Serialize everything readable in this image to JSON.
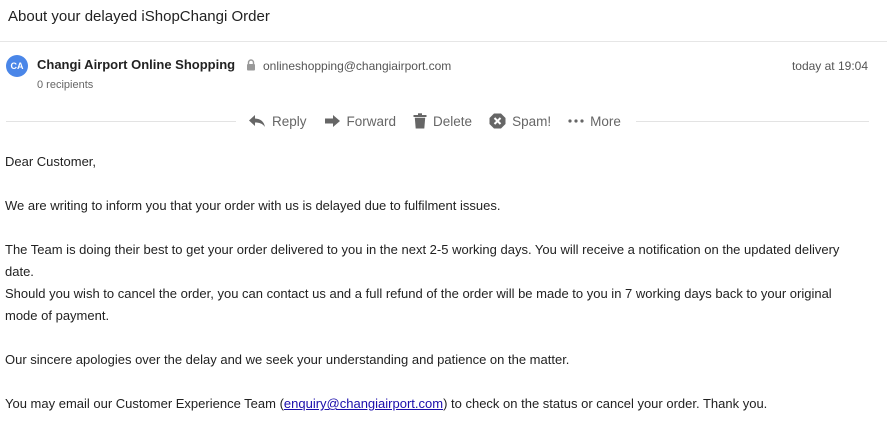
{
  "email": {
    "subject": "About your delayed iShopChangi Order",
    "sender": {
      "initials": "CA",
      "name": "Changi Airport Online Shopping",
      "address": "onlineshopping@changiairport.com",
      "avatar_color": "#4a86e8"
    },
    "recipients": "0 recipients",
    "timestamp": "today at 19:04"
  },
  "toolbar": {
    "reply": "Reply",
    "forward": "Forward",
    "delete": "Delete",
    "spam": "Spam!",
    "more": "More",
    "icons": [
      "reply-icon",
      "forward-icon",
      "trash-icon",
      "spam-icon",
      "more-icon"
    ]
  },
  "body": {
    "greeting": "Dear Customer,",
    "p1": "We are writing to inform you that your order with us is delayed due to fulfilment issues.",
    "p2": "The Team is doing their best to get your order delivered to you in the next 2-5 working days. You will receive a notification on the updated delivery date.",
    "p3": "Should you wish to cancel the order, you can contact us and a full refund of the order will be made to you in 7 working days back to your original mode of payment.",
    "p4": "Our sincere apologies over the delay and we seek your understanding and patience on the matter.",
    "p5_before": "You may email our Customer Experience Team (",
    "p5_link": "enquiry@changiairport.com",
    "p5_after": ") to check on the status or cancel your order. Thank you."
  }
}
